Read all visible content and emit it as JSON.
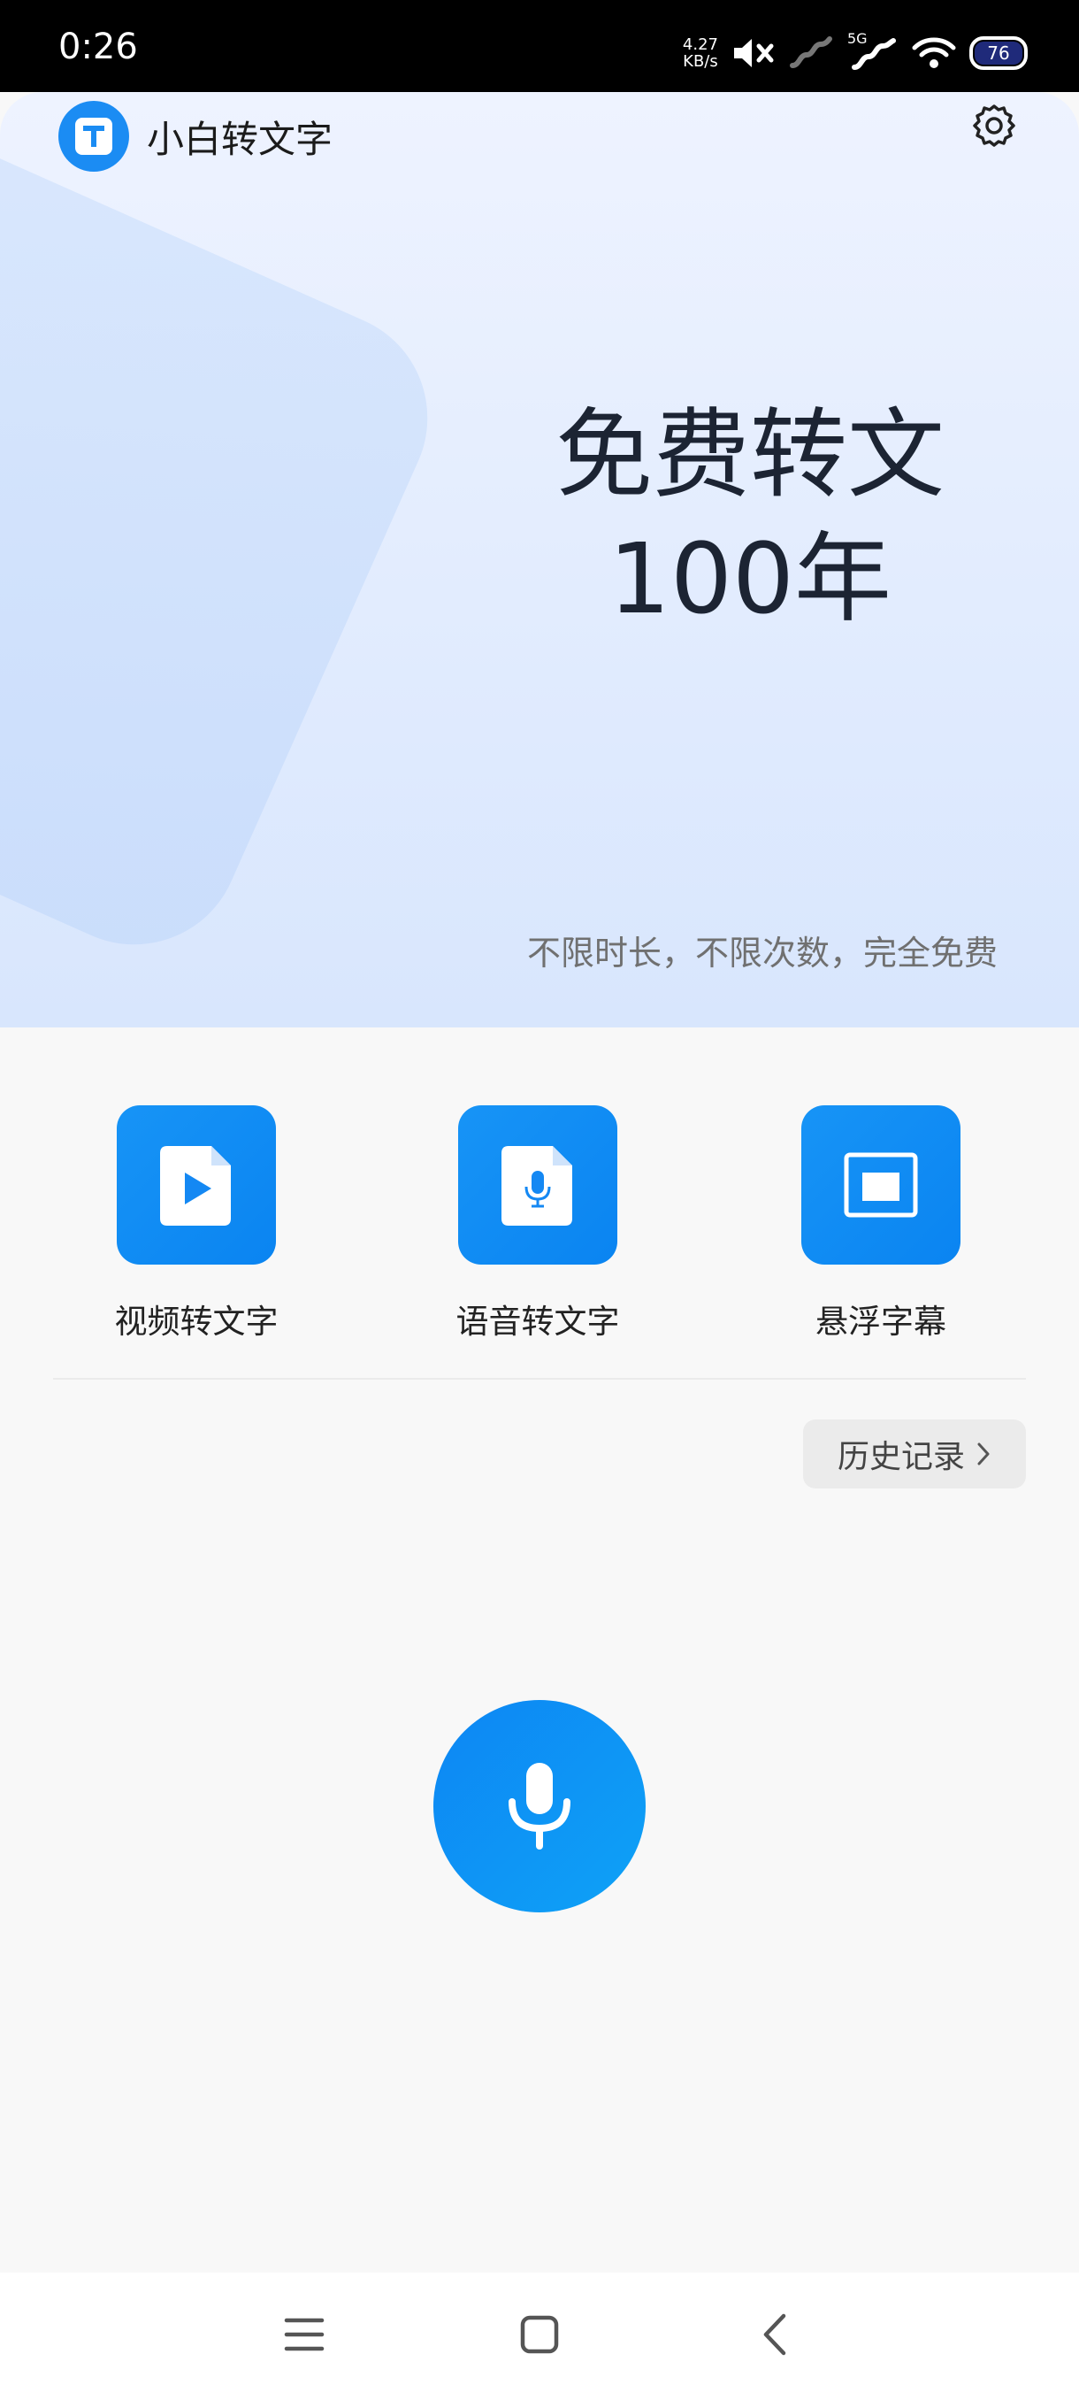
{
  "status_bar": {
    "time": "0:26",
    "net_speed_value": "4.27",
    "net_speed_unit": "KB/s",
    "network_label": "5G",
    "battery": "76"
  },
  "header": {
    "app_name": "小白转文字",
    "logo_icon": "app-logo-t-icon",
    "settings_icon": "gear-icon"
  },
  "hero": {
    "headline_line1": "免费转文",
    "headline_line2": "100年",
    "tagline": "不限时长，不限次数，完全免费"
  },
  "features": [
    {
      "label": "视频转文字",
      "icon": "video-file-icon"
    },
    {
      "label": "语音转文字",
      "icon": "audio-file-icon"
    },
    {
      "label": "悬浮字幕",
      "icon": "floating-window-icon"
    }
  ],
  "history": {
    "label": "历史记录"
  },
  "record": {
    "icon": "microphone-icon"
  },
  "nav": {
    "menu_icon": "menu-icon",
    "home_icon": "home-icon",
    "back_icon": "back-icon"
  },
  "colors": {
    "accent": "#1B8CF3",
    "hero_top": "#EEF3FF",
    "hero_bottom": "#D8E6FD"
  }
}
